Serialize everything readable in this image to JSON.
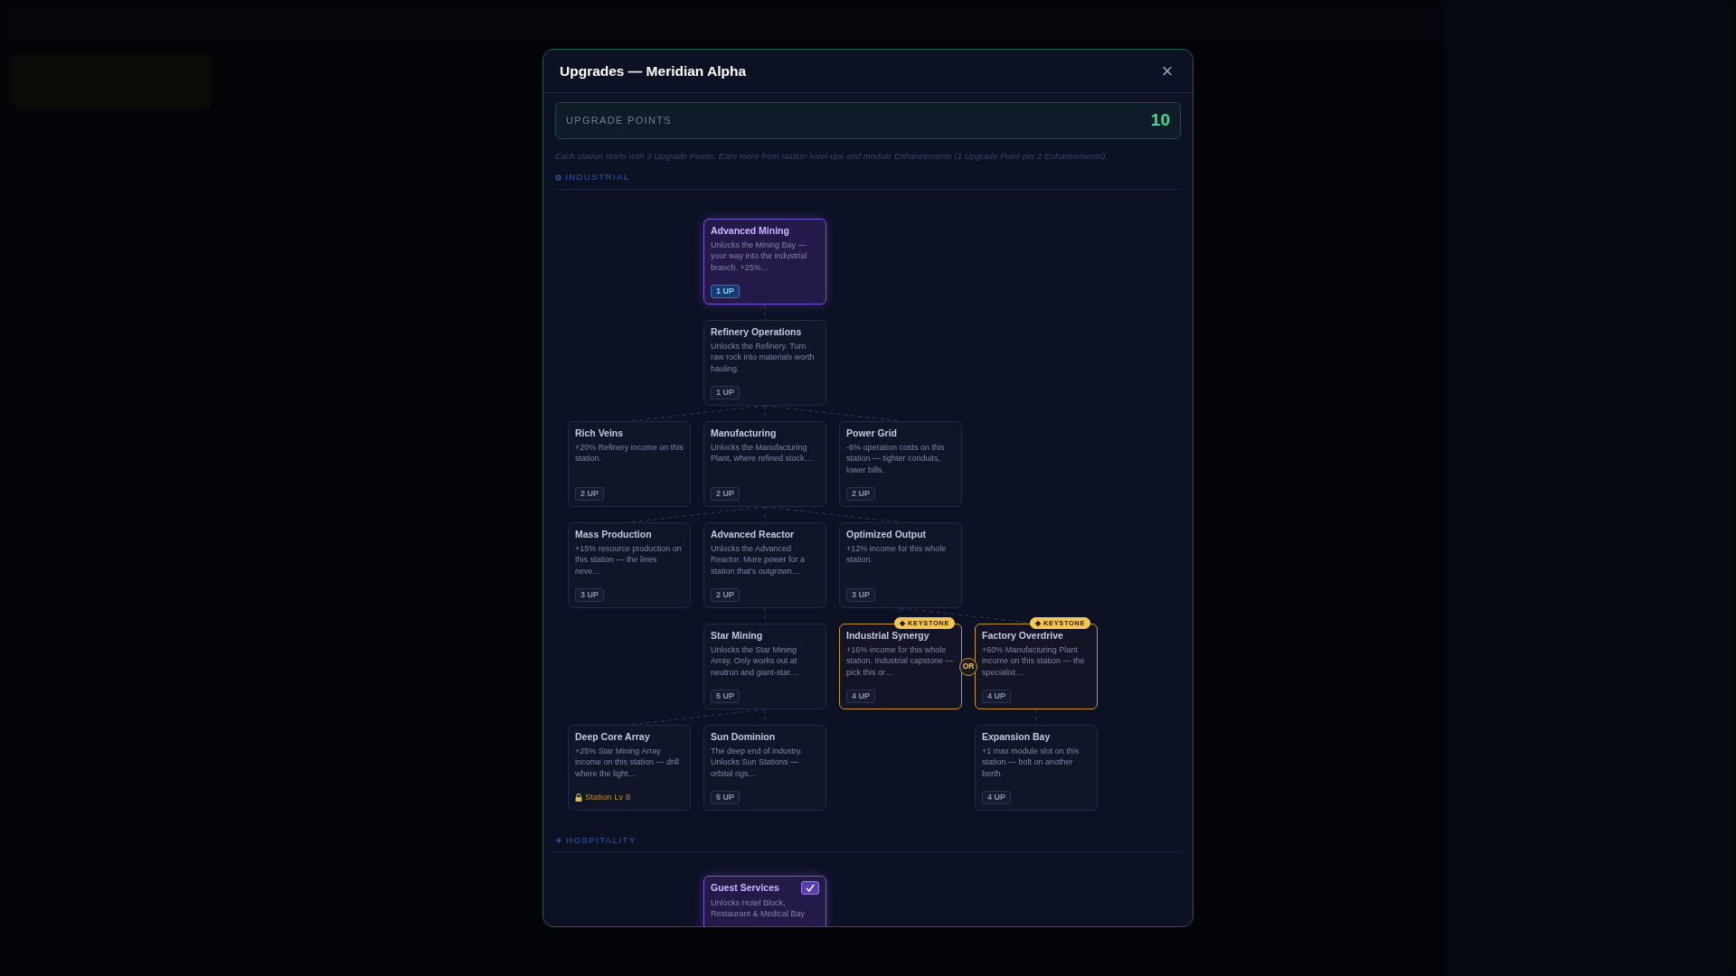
{
  "modal": {
    "title": "Upgrades — Meridian Alpha",
    "close": "×"
  },
  "points": {
    "label": "UPGRADE POINTS",
    "value": "10"
  },
  "note": "Each station starts with 3 Upgrade Points. Earn more from station level-ups and module Enhancements (1 Upgrade Point per 2 Enhancements).",
  "sections": [
    {
      "kind": "industrial",
      "title": "INDUSTRIAL",
      "choice": {
        "label": "OR"
      },
      "nodes": [
        {
          "title": "Advanced Mining",
          "description": "Unlocks the Mining Bay — your way into the industrial branch. +25%…",
          "cost": "1 UP",
          "selected": true,
          "keystone": false
        },
        {
          "title": "Refinery Operations",
          "description": "Unlocks the Refinery. Turn raw rock into materials worth hauling.",
          "cost": "1 UP",
          "selected": false,
          "keystone": false
        },
        {
          "title": "Rich Veins",
          "description": "+20% Refinery income on this station.",
          "cost": "2 UP",
          "selected": false,
          "keystone": false
        },
        {
          "title": "Manufacturing",
          "description": "Unlocks the Manufacturing Plant, where refined stock…",
          "cost": "2 UP",
          "selected": false,
          "keystone": false
        },
        {
          "title": "Power Grid",
          "description": "-6% operation costs on this station — tighter conduits, lower bills.",
          "cost": "2 UP",
          "selected": false,
          "keystone": false
        },
        {
          "title": "Mass Production",
          "description": "+15% resource production on this station — the lines neve…",
          "cost": "3 UP",
          "selected": false,
          "keystone": false
        },
        {
          "title": "Advanced Reactor",
          "description": "Unlocks the Advanced Reactor. More power for a station that's outgrown…",
          "cost": "2 UP",
          "selected": false,
          "keystone": false
        },
        {
          "title": "Optimized Output",
          "description": "+12% income for this whole station.",
          "cost": "3 UP",
          "selected": false,
          "keystone": false
        },
        {
          "title": "Star Mining",
          "description": "Unlocks the Star Mining Array. Only works out at neutron and giant-star…",
          "cost": "5 UP",
          "selected": false,
          "keystone": false
        },
        {
          "title": "Industrial Synergy",
          "description": "+16% income for this whole station. Industrial capstone — pick this or…",
          "cost": "4 UP",
          "selected": false,
          "keystone": true,
          "badge": "◆ KEYSTONE"
        },
        {
          "title": "Factory Overdrive",
          "description": "+60% Manufacturing Plant income on this station — the specialist…",
          "cost": "4 UP",
          "selected": false,
          "keystone": true,
          "badge": "◆ KEYSTONE"
        },
        {
          "title": "Deep Core Array",
          "description": "+25% Star Mining Array income on this station — drill where the light…",
          "requirement": "Station Lv 8",
          "selected": false,
          "keystone": false
        },
        {
          "title": "Sun Dominion",
          "description": "The deep end of industry. Unlocks Sun Stations — orbital rigs…",
          "cost": "5 UP",
          "selected": false,
          "keystone": false
        },
        {
          "title": "Expansion Bay",
          "description": "+1 max module slot on this station — bolt on another berth.",
          "cost": "4 UP",
          "selected": false,
          "keystone": false
        }
      ]
    },
    {
      "kind": "hospitality",
      "title": "HOSPITALITY",
      "nodes": [
        {
          "title": "Guest Services",
          "description": "Unlocks Hotel Block, Restaurant & Medical Bay",
          "selected": true,
          "keystone": false,
          "checked": true
        }
      ]
    }
  ]
}
